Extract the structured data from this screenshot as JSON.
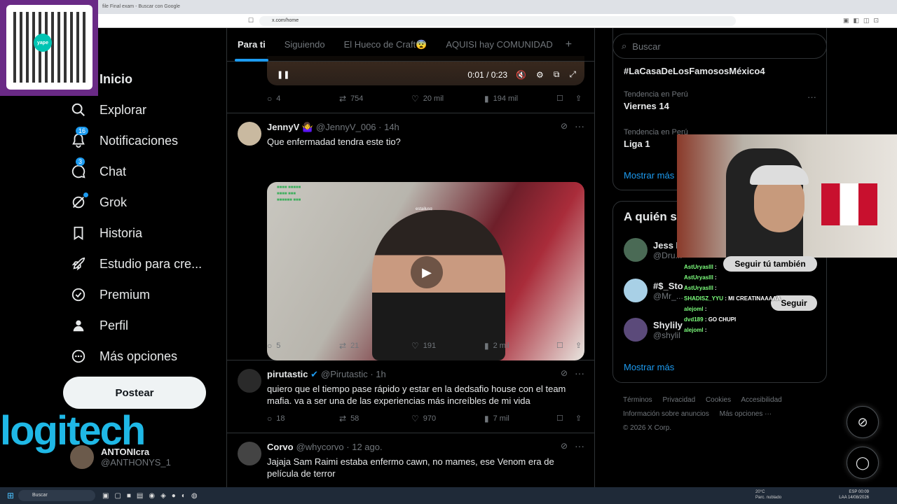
{
  "browser": {
    "tab_title": "file Final exam - Buscar con Google",
    "url": "x.com/home"
  },
  "overlay": {
    "qr_brand": "yape",
    "logitech_text": "logitech",
    "follow_label": "Seguir tú también",
    "follow2_label": "Seguir",
    "chat": [
      {
        "user": "AstUryaslll",
        "msg": ":"
      },
      {
        "user": "AstUryaslll",
        "msg": ":"
      },
      {
        "user": "AstUryaslll",
        "msg": ":"
      },
      {
        "user": "SHADISZ_YYU",
        "msg": ": MI CREATINAAAAA"
      },
      {
        "user": "alejoml",
        "msg": ":"
      },
      {
        "user": "dvd189",
        "msg": ": GO CHUPI"
      },
      {
        "user": "alejoml",
        "msg": ":"
      }
    ]
  },
  "sidebar": {
    "items": [
      {
        "label": "Inicio",
        "icon": "home-icon"
      },
      {
        "label": "Explorar",
        "icon": "search-icon"
      },
      {
        "label": "Notificaciones",
        "icon": "bell-icon",
        "badge": "16"
      },
      {
        "label": "Chat",
        "icon": "chat-icon",
        "badge": "3"
      },
      {
        "label": "Grok",
        "icon": "grok-icon"
      },
      {
        "label": "Historia",
        "icon": "bookmark-icon"
      },
      {
        "label": "Estudio para cre...",
        "icon": "rocket-icon"
      },
      {
        "label": "Premium",
        "icon": "verified-icon"
      },
      {
        "label": "Perfil",
        "icon": "person-icon"
      },
      {
        "label": "Más opciones",
        "icon": "more-circle-icon"
      }
    ],
    "post_label": "Postear",
    "account_name": "ANTONIcra",
    "account_handle": "@ANTHONYS_1"
  },
  "timeline": {
    "tabs": [
      "Para ti",
      "Siguiendo",
      "El Hueco de Craft😨",
      "AQUISI hay COMUNIDAD"
    ],
    "video_time": "0:01 / 0:23",
    "tweet0": {
      "replies": "4",
      "reposts": "754",
      "likes": "20 mil",
      "views": "194 mil"
    },
    "tweet1": {
      "name": "JennyV 🤷‍♀️",
      "handle": "@JennyV_006",
      "time": "· 14h",
      "text": "Que enfermadad tendra este tio?",
      "replies": "5",
      "reposts": "21",
      "likes": "191",
      "views": "2 mil",
      "overlay_chat": "estailusg"
    },
    "tweet2": {
      "name": "pirutastic",
      "handle": "@Pirutastic",
      "time": "· 1h",
      "text": "quiero que el tiempo pase rápido y estar en la dedsafio house con el team mafia. va a ser una de las experiencias más increíbles de mi vida",
      "replies": "18",
      "reposts": "58",
      "likes": "970",
      "views": "7 mil"
    },
    "tweet3": {
      "name": "Corvo",
      "handle": "@whycorvo",
      "time": "· 12 ago.",
      "text": "Jajaja Sam Raimi estaba enfermo cawn, no mames, ese Venom era de película de terror"
    }
  },
  "right": {
    "search_placeholder": "Buscar",
    "trends": [
      {
        "context": "",
        "title": "#LaCasaDeLosFamososMéxico4"
      },
      {
        "context": "Tendencia en Perú",
        "title": "Viernes 14"
      },
      {
        "context": "Tendencia en Perú",
        "title": "Liga 1"
      }
    ],
    "show_more": "Mostrar más",
    "who_title": "A quién s",
    "who": [
      {
        "name": "Jess P",
        "handle": "@Dru..."
      },
      {
        "name": "#$_Sto",
        "handle": "@Mr_..."
      },
      {
        "name": "Shylily",
        "handle": "@shylil"
      }
    ],
    "footer": [
      "Términos",
      "Privacidad",
      "Cookies",
      "Accesibilidad",
      "Información sobre anuncios",
      "Más opciones ···",
      "© 2026 X Corp."
    ]
  },
  "taskbar": {
    "search": "Buscar",
    "weather": "20°C",
    "weather_desc": "Parc. nublado",
    "lang": "ESP",
    "lang2": "LAA",
    "time": "00:09",
    "date": "14/08/2026"
  }
}
